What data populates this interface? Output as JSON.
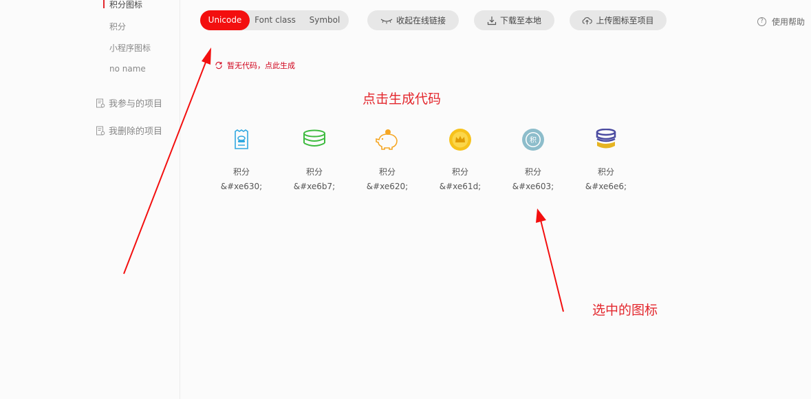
{
  "sidebar": {
    "items": [
      {
        "label": "积分图标",
        "active": true
      },
      {
        "label": "积分"
      },
      {
        "label": "小程序图标"
      },
      {
        "label": "no name"
      }
    ],
    "groups": [
      {
        "label": "我参与的项目",
        "icon": "project-doc-icon"
      },
      {
        "label": "我删除的项目",
        "icon": "deleted-doc-icon"
      }
    ]
  },
  "toolbar": {
    "tabs": [
      "Unicode",
      "Font class",
      "Symbol"
    ],
    "active_tab": "Unicode",
    "collapse_label": "收起在线链接",
    "download_label": "下载至本地",
    "upload_label": "上传图标至项目",
    "help_label": "使用帮助"
  },
  "code_panel": {
    "no_code_label": "暂无代码，点此生成"
  },
  "annotations": {
    "generate": "点击生成代码",
    "selected": "选中的图标"
  },
  "icons": [
    {
      "name": "积分",
      "code": "&#xe630;",
      "icon": "receipt-icon",
      "color": "#2fa8e0"
    },
    {
      "name": "积分",
      "code": "&#xe6b7;",
      "icon": "coin-stack-icon",
      "color": "#3dbb3f"
    },
    {
      "name": "积分",
      "code": "&#xe620;",
      "icon": "piggy-bank-icon",
      "color": "#f5a623"
    },
    {
      "name": "积分",
      "code": "&#xe61d;",
      "icon": "crown-coin-icon",
      "color": "#f7c21b"
    },
    {
      "name": "积分",
      "code": "&#xe603;",
      "icon": "points-badge-icon",
      "color": "#8dbdcb"
    },
    {
      "name": "积分",
      "code": "&#xe6e6;",
      "icon": "database-coins-icon",
      "color": "#4a4aa0"
    }
  ],
  "colors": {
    "accent": "#f30f0f",
    "annotation": "#e3272d"
  }
}
